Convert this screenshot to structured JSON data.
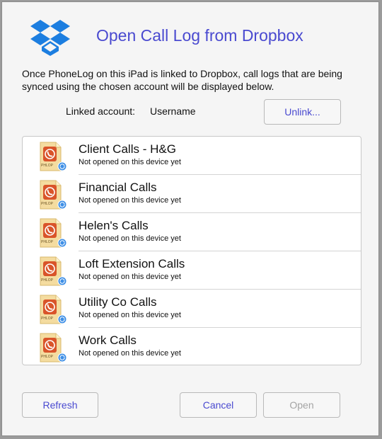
{
  "dialog": {
    "title": "Open Call Log from Dropbox",
    "description": "Once PhoneLog on this iPad is linked to Dropbox, call logs that are being synced using the chosen account will be displayed below.",
    "linked_account_label": "Linked account:",
    "linked_account_value": "Username",
    "unlink_label": "Unlink...",
    "refresh_label": "Refresh",
    "cancel_label": "Cancel",
    "open_label": "Open",
    "open_enabled": false
  },
  "files": [
    {
      "name": "Client Calls - H&G",
      "status": "Not opened on this device yet"
    },
    {
      "name": "Financial Calls",
      "status": "Not opened on this device yet"
    },
    {
      "name": "Helen's Calls",
      "status": "Not opened on this device yet"
    },
    {
      "name": "Loft Extension Calls",
      "status": "Not opened on this device yet"
    },
    {
      "name": "Utility Co Calls",
      "status": "Not opened on this device yet"
    },
    {
      "name": "Work Calls",
      "status": "Not opened on this device yet"
    }
  ],
  "file_icon_label": "PHLOP",
  "icons": {
    "logo": "dropbox-logo",
    "file": "phonelog-file-icon",
    "sync": "sync-badge-icon"
  },
  "colors": {
    "accent": "#4a4ad0",
    "dropbox_blue": "#1c7ee0",
    "disabled_text": "#a4a4a4",
    "file_icon_orange": "#d9542a"
  }
}
